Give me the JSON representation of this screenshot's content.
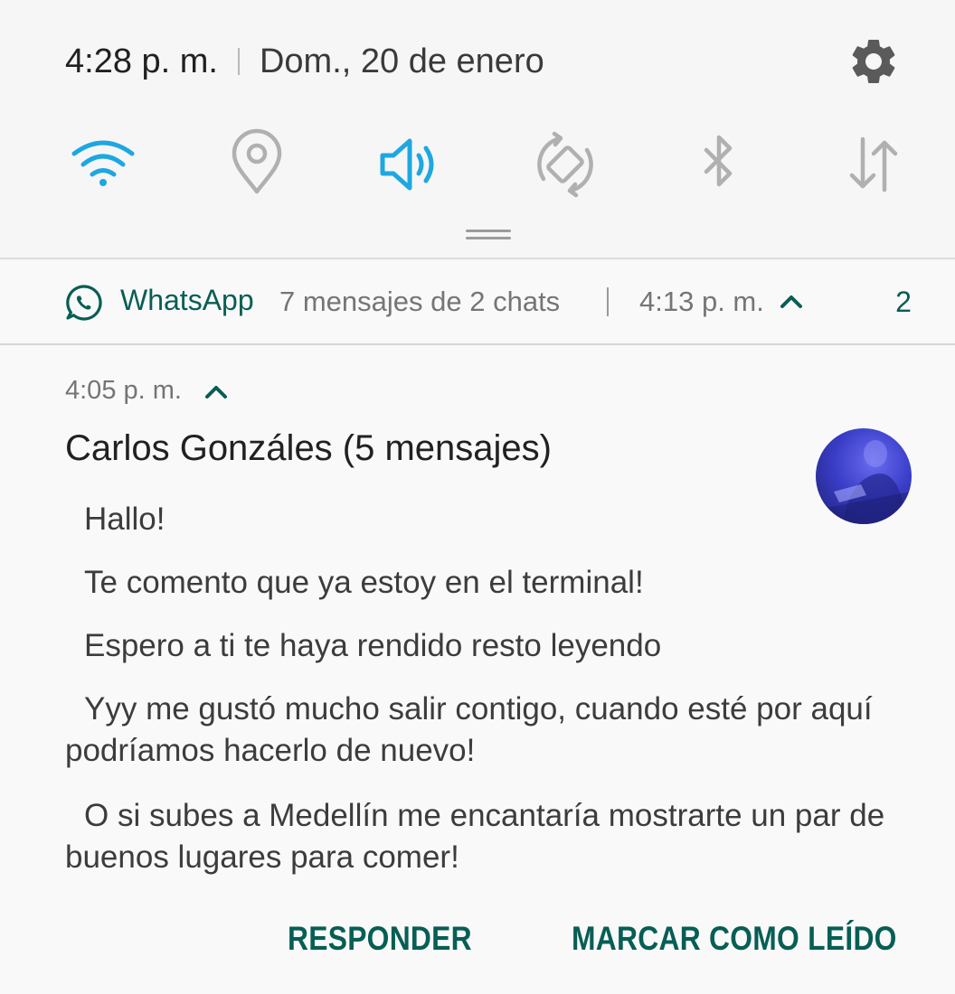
{
  "status_bar": {
    "time": "4:28 p. m.",
    "date": "Dom., 20 de enero"
  },
  "quick_settings": {
    "tiles": [
      {
        "name": "wifi",
        "active": true
      },
      {
        "name": "location",
        "active": false
      },
      {
        "name": "sound",
        "active": true
      },
      {
        "name": "auto-rotate",
        "active": false
      },
      {
        "name": "bluetooth",
        "active": false
      },
      {
        "name": "mobile-data",
        "active": false
      }
    ],
    "active_color": "#1ea7e1",
    "inactive_color": "#b0b0b0"
  },
  "notification": {
    "app_name": "WhatsApp",
    "summary": "7 mensajes de 2 chats",
    "time": "4:13 p. m.",
    "count": "2",
    "accent_color": "#075e54",
    "conversation": {
      "time": "4:05 p. m.",
      "title": "Carlos Gonzáles (5 mensajes)",
      "messages": [
        "Hallo!",
        "Te comento que ya estoy en el terminal!",
        "Espero a ti te haya rendido resto leyendo",
        "Yyy me gustó mucho salir contigo, cuando esté por aquí podríamos hacerlo de nuevo!",
        "O si subes a Medellín me encantaría mostrarte un par de buenos lugares para comer!"
      ]
    },
    "actions": {
      "reply": "RESPONDER",
      "mark_read": "MARCAR COMO LEÍDO"
    }
  }
}
